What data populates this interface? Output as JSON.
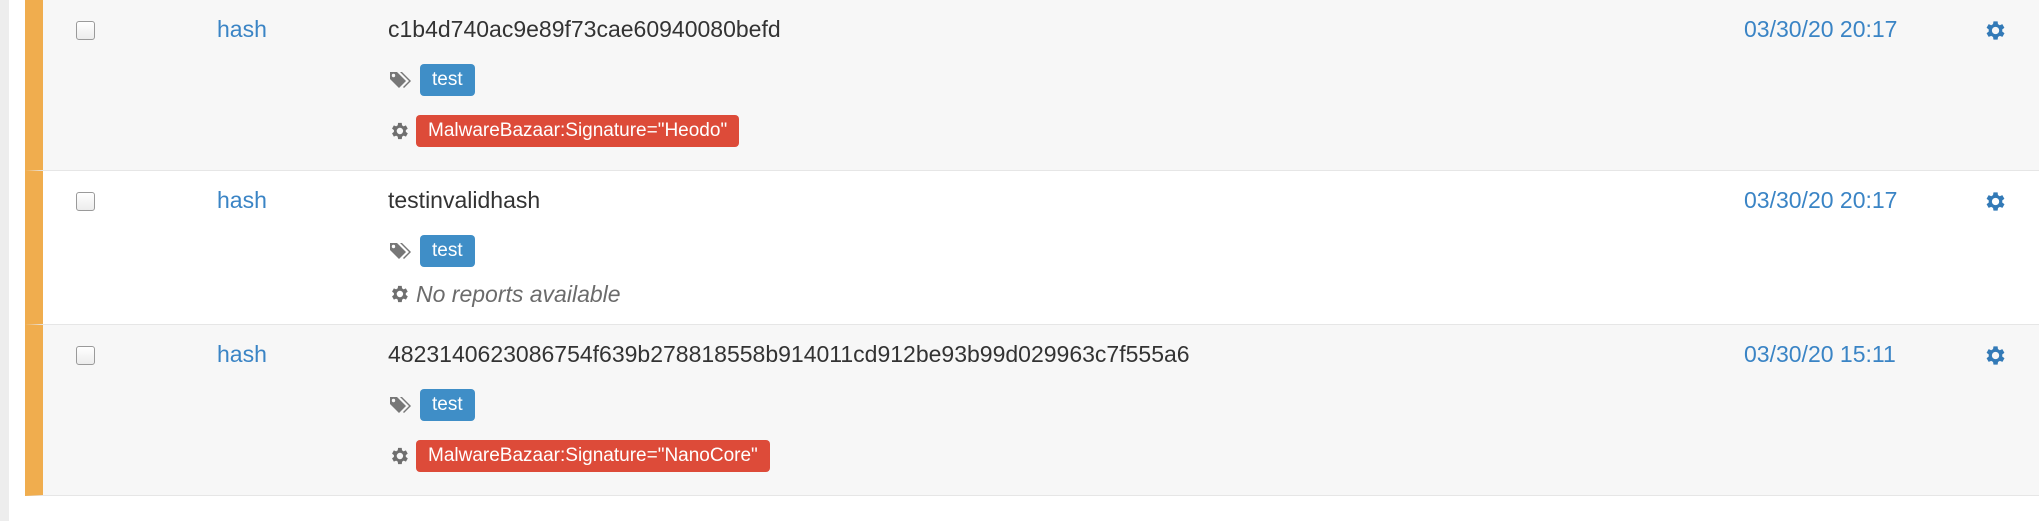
{
  "rows": [
    {
      "type": "hash",
      "value": "c1b4d740ac9e89f73cae60940080befd",
      "tags": [
        "test"
      ],
      "report": {
        "kind": "badge",
        "label": "MalwareBazaar:Signature=\"Heodo\""
      },
      "date": "03/30/20 20:17",
      "selected": false
    },
    {
      "type": "hash",
      "value": "testinvalidhash",
      "tags": [
        "test"
      ],
      "report": {
        "kind": "text",
        "label": "No reports available"
      },
      "date": "03/30/20 20:17",
      "selected": false
    },
    {
      "type": "hash",
      "value": "4823140623086754f639b278818558b914011cd912be93b99d029963c7f555a6",
      "tags": [
        "test"
      ],
      "report": {
        "kind": "badge",
        "label": "MalwareBazaar:Signature=\"NanoCore\""
      },
      "date": "03/30/20 15:11",
      "selected": false
    }
  ],
  "colors": {
    "row_accent": "#f0ad4e",
    "link": "#3a84c5",
    "tag_badge": "#3f8ec7",
    "report_badge": "#dd4b39"
  },
  "icons": {
    "tag": "tags-icon",
    "report": "gear-icon",
    "actions": "gear-icon"
  }
}
